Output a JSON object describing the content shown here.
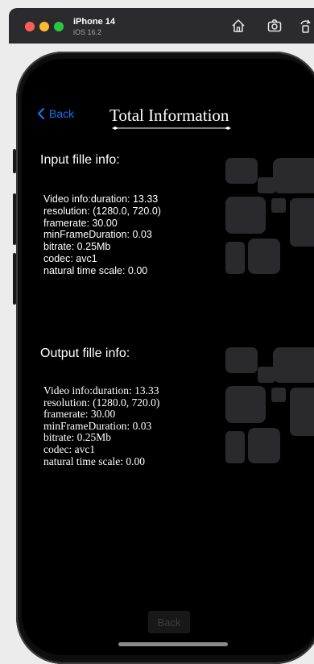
{
  "simulator": {
    "device_name": "iPhone 14",
    "os_version": "iOS 16.2",
    "toolbar_icons": [
      "home-icon",
      "screenshot-icon",
      "rotate-icon"
    ]
  },
  "nav": {
    "back_label": "Back",
    "title": "Total Information"
  },
  "input_section": {
    "title": "Input fille info:",
    "lines": [
      "Video info:duration: 13.33",
      "resolution: (1280.0, 720.0)",
      "framerate: 30.00",
      "minFrameDuration: 0.03",
      "bitrate: 0.25Mb",
      "codec: avc1",
      "natural time scale: 0.00"
    ]
  },
  "output_section": {
    "title": "Output fille info:",
    "lines": [
      "Video info:duration: 13.33",
      "resolution: (1280.0, 720.0)",
      "framerate: 30.00",
      "minFrameDuration: 0.03",
      "bitrate: 0.25Mb",
      "codec: avc1",
      "natural time scale: 0.00"
    ]
  },
  "bottom_button": {
    "label": "Back"
  },
  "colors": {
    "accent": "#1a73f0",
    "screen_background": "#000000",
    "text": "#ffffff",
    "decoration": "#2a2a2c"
  }
}
